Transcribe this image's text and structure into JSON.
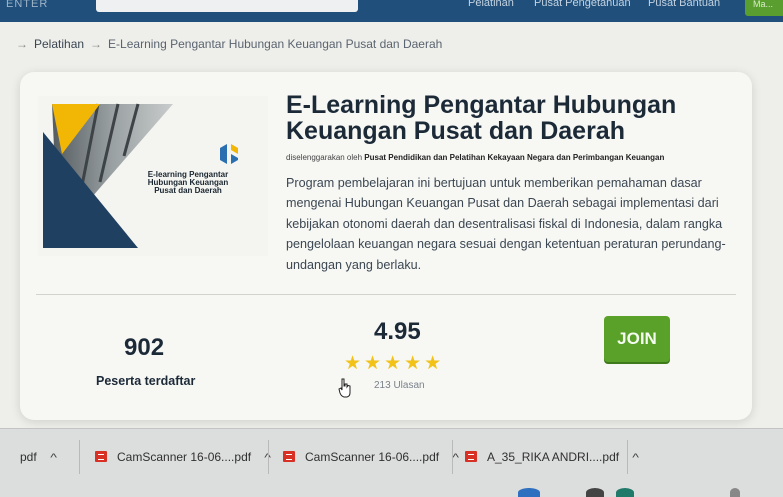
{
  "nav": {
    "brand_fragment": "ENTER",
    "items": [
      "Pelatihan",
      "Pusat Pengetahuan",
      "Pusat Bantuan"
    ],
    "login_label": "Ma..."
  },
  "breadcrumb": {
    "link": "Pelatihan",
    "arrow": "→",
    "current": "E-Learning Pengantar Hubungan Keuangan Pusat dan Daerah"
  },
  "course": {
    "thumbnail_title": "E-learning Pengantar Hubungan Keuangan Pusat dan Daerah",
    "title": "E-Learning Pengantar Hubungan Keuangan Pusat dan Daerah",
    "organizer_prefix": "diselenggarakan oleh",
    "organizer": "Pusat Pendidikan dan Pelatihan Kekayaan Negara dan Perimbangan Keuangan",
    "description": "Program pembelajaran ini bertujuan untuk memberikan pemahaman dasar mengenai Hubungan Keuangan Pusat dan Daerah sebagai implementasi dari kebijakan otonomi daerah dan desentralisasi fiskal di Indonesia, dalam rangka pengelolaan keuangan negara sesuai dengan ketentuan peraturan perundang- undangan yang berlaku.",
    "participants_count": "902",
    "participants_label": "Peserta terdaftar",
    "rating": "4.95",
    "stars": "★★★★★",
    "reviews": "213 Ulasan",
    "join_label": "JOIN"
  },
  "downloads": [
    {
      "name": "pdf"
    },
    {
      "name": "CamScanner 16-06....pdf"
    },
    {
      "name": "CamScanner 16-06....pdf"
    },
    {
      "name": "A_35_RIKA ANDRI....pdf"
    }
  ],
  "colors": {
    "nav_bg": "#1f4f7a",
    "join_green": "#5aa12a",
    "star_yellow": "#f2c218",
    "thumb_navy": "#1f4060",
    "thumb_yellow": "#f2b705",
    "pdf_red": "#d93025"
  }
}
